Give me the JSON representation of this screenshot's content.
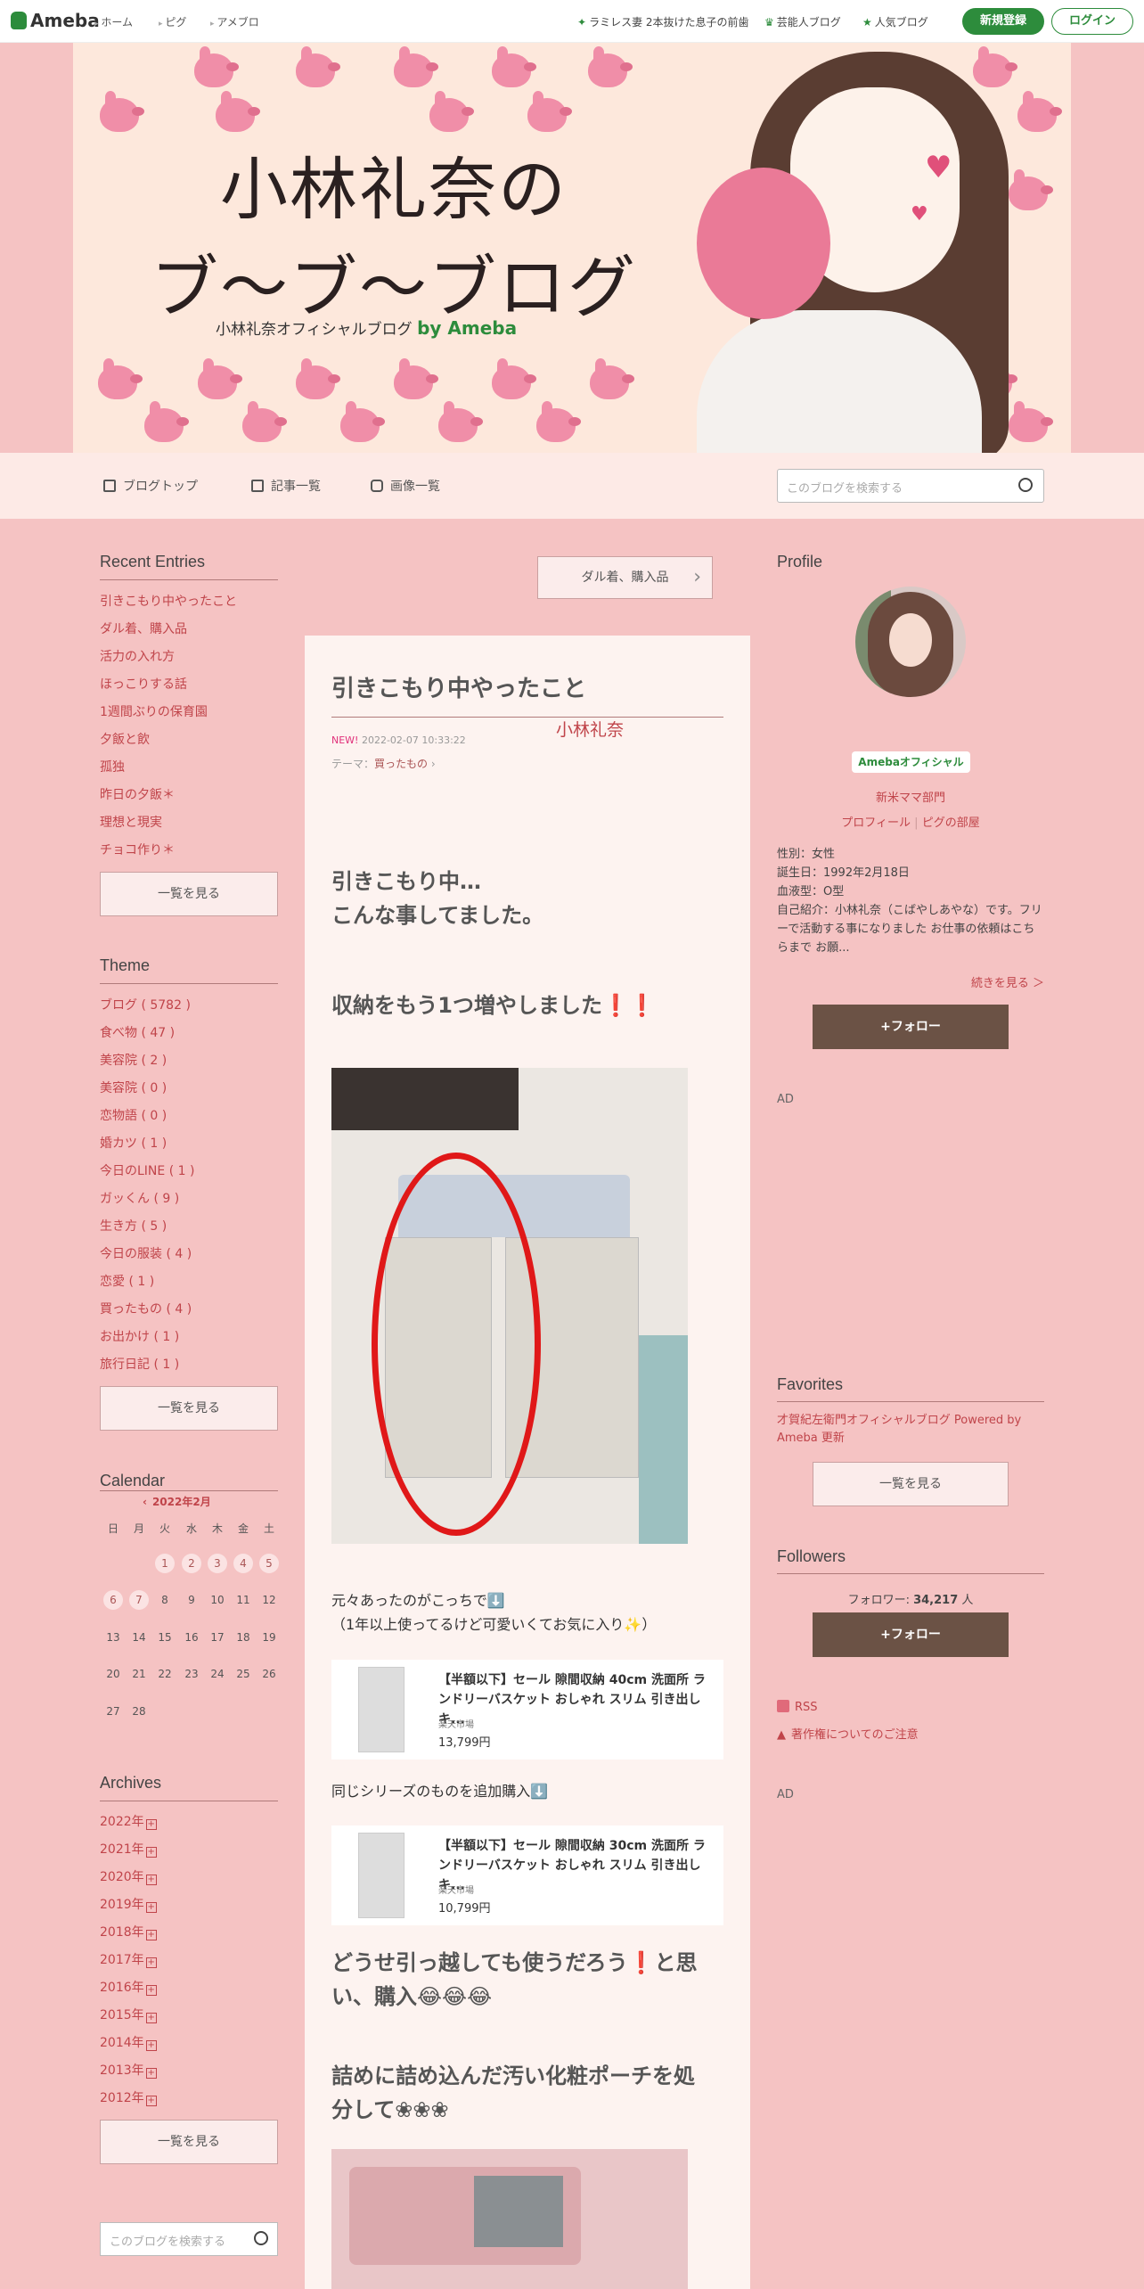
{
  "topbar": {
    "logo": "Ameba",
    "crumbs": [
      "ホーム",
      "ピグ",
      "アメブロ"
    ],
    "links": [
      "ラミレス妻 2本抜けた息子の前歯",
      "芸能人ブログ",
      "人気ブログ"
    ],
    "register": "新規登録",
    "login": "ログイン"
  },
  "banner": {
    "title_line1": "小林礼奈の",
    "title_line2": "ブ〜ブ〜ブログ",
    "subtitle": "小林礼奈オフィシャルブログ",
    "by": "by Ameba"
  },
  "blognav": {
    "top": "ブログトップ",
    "list": "記事一覧",
    "images": "画像一覧",
    "search_placeholder": "このブログを検索する"
  },
  "recent": {
    "heading": "Recent Entries",
    "items": [
      "引きこもり中やったこと",
      "ダル着、購入品",
      "活力の入れ方",
      "ほっこりする話",
      "1週間ぶりの保育園",
      "夕飯と飲",
      "孤独",
      "昨日の夕飯＊",
      "理想と現実",
      "チョコ作り＊"
    ],
    "more": "一覧を見る"
  },
  "theme": {
    "heading": "Theme",
    "items": [
      "ブログ ( 5782 )",
      "食べ物 ( 47 )",
      "美容院 ( 2 )",
      "美容院 ( 0 )",
      "恋物語 ( 0 )",
      "婚カツ ( 1 )",
      "今日のLINE ( 1 )",
      "ガッくん ( 9 )",
      "生き方 ( 5 )",
      "今日の服装 ( 4 )",
      "恋愛 ( 1 )",
      "買ったもの ( 4 )",
      "お出かけ ( 1 )",
      "旅行日記 ( 1 )"
    ],
    "more": "一覧を見る"
  },
  "calendar": {
    "heading": "Calendar",
    "month": "2022年2月",
    "weekdays": [
      "日",
      "月",
      "火",
      "水",
      "木",
      "金",
      "土"
    ],
    "weeks": [
      [
        "",
        "",
        "1",
        "2",
        "3",
        "4",
        "5"
      ],
      [
        "6",
        "7",
        "8",
        "9",
        "10",
        "11",
        "12"
      ],
      [
        "13",
        "14",
        "15",
        "16",
        "17",
        "18",
        "19"
      ],
      [
        "20",
        "21",
        "22",
        "23",
        "24",
        "25",
        "26"
      ],
      [
        "27",
        "28",
        "",
        "",
        "",
        "",
        ""
      ]
    ],
    "linked_days": [
      "1",
      "2",
      "3",
      "4",
      "5",
      "6",
      "7"
    ]
  },
  "archives": {
    "heading": "Archives",
    "items": [
      "2022年",
      "2021年",
      "2020年",
      "2019年",
      "2018年",
      "2017年",
      "2016年",
      "2015年",
      "2014年",
      "2013年",
      "2012年"
    ],
    "more": "一覧を見る"
  },
  "bottom_search_placeholder": "このブログを検索する",
  "article": {
    "next_label": "ダル着、購入品",
    "title": "引きこもり中やったこと",
    "new": "NEW!",
    "date": "2022-02-07 10:33:22",
    "theme_label": "テーマ：",
    "theme_value": "買ったもの",
    "h1_line1": "引きこもり中…",
    "h1_line2": "こんな事してました。",
    "h2": "収納をもう1つ増やしました❗️❗️",
    "p1_line1": "元々あったのがこっちで⬇️",
    "p1_line2": "（1年以上使ってるけど可愛いくてお気に入り✨）",
    "product1": {
      "name": "【半額以下】セール 隙間収納 40cm 洗面所 ランドリーバスケット おしゃれ スリム 引き出し キ...",
      "shop": "楽天市場",
      "price": "13,799円"
    },
    "p2": "同じシリーズのものを追加購入⬇️",
    "product2": {
      "name": "【半額以下】セール 隙間収納 30cm 洗面所 ランドリーバスケット おしゃれ スリム 引き出し キ...",
      "shop": "楽天市場",
      "price": "10,799円"
    },
    "h3_line1": "どうせ引っ越しても使うだろう❗️と思",
    "h3_line2": "い、購入😂😂😂",
    "h4_line1": "詰めに詰め込んだ汚い化粧ポーチを処",
    "h4_line2": "分して❀❀❀"
  },
  "profile": {
    "heading": "Profile",
    "name": "小林礼奈",
    "badge": "Amebaオフィシャル",
    "category": "新米ママ部門",
    "link_profile": "プロフィール",
    "link_room": "ピグの部屋",
    "gender": "性別：女性",
    "birthday": "誕生日：1992年2月18日",
    "blood": "血液型：O型",
    "intro": "自己紹介：小林礼奈（こばやしあやな）です。フリーで活動する事になりました お仕事の依頼はこちらまで お願...",
    "read_more": "続きを見る ＞",
    "follow": "+フォロー"
  },
  "ad_label": "AD",
  "favorites": {
    "heading": "Favorites",
    "item": "才賀紀左衛門オフィシャルブログ Powered by Ameba 更新",
    "more": "一覧を見る"
  },
  "followers": {
    "heading": "Followers",
    "count_label": "フォロワー:",
    "count": "34,217",
    "unit": "人",
    "follow": "+フォロー"
  },
  "footer_links": {
    "rss": "RSS",
    "copyright": "著作権についてのご注意"
  },
  "colors": {
    "accent_green": "#2d8c3c",
    "page_bg": "#f5c3c3",
    "link_red": "#c0444a",
    "follow_brown": "#6b5245"
  }
}
